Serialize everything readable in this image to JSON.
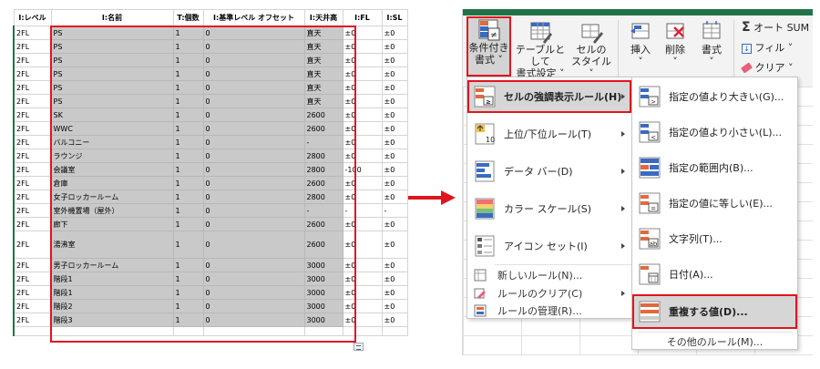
{
  "sheet": {
    "headers": [
      "I:レベル",
      "I:名前",
      "T:個数",
      "I:基準レベル オフセット",
      "I:天井高",
      "I:FL",
      "I:SL"
    ],
    "rows": [
      [
        "2FL",
        "PS",
        "1",
        "0",
        "直天",
        "±0",
        "±0"
      ],
      [
        "2FL",
        "PS",
        "1",
        "0",
        "直天",
        "±0",
        "±0"
      ],
      [
        "2FL",
        "PS",
        "1",
        "0",
        "直天",
        "±0",
        "±0"
      ],
      [
        "2FL",
        "PS",
        "1",
        "0",
        "直天",
        "±0",
        "±0"
      ],
      [
        "2FL",
        "PS",
        "1",
        "0",
        "直天",
        "±0",
        "±0"
      ],
      [
        "2FL",
        "PS",
        "1",
        "0",
        "直天",
        "±0",
        "±0"
      ],
      [
        "2FL",
        "SK",
        "1",
        "0",
        "2600",
        "±0",
        "±0"
      ],
      [
        "2FL",
        "WWC",
        "1",
        "0",
        "2600",
        "±0",
        "±0"
      ],
      [
        "2FL",
        "バルコニー",
        "1",
        "0",
        "-",
        "±0",
        "±0"
      ],
      [
        "2FL",
        "ラウンジ",
        "1",
        "0",
        "2800",
        "±0",
        "±0"
      ],
      [
        "2FL",
        "会議室",
        "1",
        "0",
        "2800",
        "-100",
        "±0"
      ],
      [
        "2FL",
        "倉庫",
        "1",
        "0",
        "2600",
        "±0",
        "±0"
      ],
      [
        "2FL",
        "女子ロッカールーム",
        "1",
        "0",
        "2800",
        "±0",
        "±0"
      ],
      [
        "2FL",
        "室外機置場（屋外）",
        "1",
        "0",
        "-",
        "-",
        "-"
      ],
      [
        "2FL",
        "廊下",
        "1",
        "0",
        "2600",
        "±0",
        "±0"
      ],
      [
        "2FL",
        "湯沸室",
        "1",
        "0",
        "2600",
        "±0",
        "±0"
      ],
      [
        "2FL",
        "男子ロッカールーム",
        "1",
        "0",
        "3000",
        "±0",
        "±0"
      ],
      [
        "2FL",
        "階段1",
        "1",
        "0",
        "3000",
        "±0",
        "±0"
      ],
      [
        "2FL",
        "階段1",
        "1",
        "0",
        "3000",
        "±0",
        "±0"
      ],
      [
        "2FL",
        "階段2",
        "1",
        "0",
        "3000",
        "±0",
        "±0"
      ],
      [
        "2FL",
        "階段3",
        "1",
        "0",
        "3000",
        "±0",
        "±0"
      ]
    ]
  },
  "ribbon": {
    "cond_format": [
      "条件付き",
      "書式 ˅"
    ],
    "format_as_table": [
      "テーブルとして",
      "書式設定 ˅"
    ],
    "cell_styles": [
      "セルの",
      "スタイル ˅"
    ],
    "insert": [
      "挿入",
      "˅"
    ],
    "delete": [
      "削除",
      "˅"
    ],
    "format": [
      "書式",
      "˅"
    ],
    "autosum": "オート SUM",
    "fill": "フィル ˅",
    "clear": "クリア ˅"
  },
  "main_menu": {
    "highlight_rules": "セルの強調表示ルール(H)",
    "top_bottom": "上位/下位ルール(T)",
    "data_bar": "データ バー(D)",
    "color_scale": "カラー スケール(S)",
    "icon_set": "アイコン セット(I)",
    "new_rule": "新しいルール(N)...",
    "clear_rules": "ルールのクリア(C)",
    "manage_rules": "ルールの管理(R)..."
  },
  "sub_menu": {
    "greater": "指定の値より大きい(G)...",
    "less": "指定の値より小さい(L)...",
    "between": "指定の範囲内(B)...",
    "equal": "指定の値に等しい(E)...",
    "text_contains": "文字列(T)...",
    "date": "日付(A)...",
    "duplicate": "重複する値(D)...",
    "more_rules": "その他のルール(M)..."
  },
  "colors": {
    "accent_red": "#e0141e",
    "excel_green": "#217346",
    "selection_gray": "#c9c9c9"
  }
}
